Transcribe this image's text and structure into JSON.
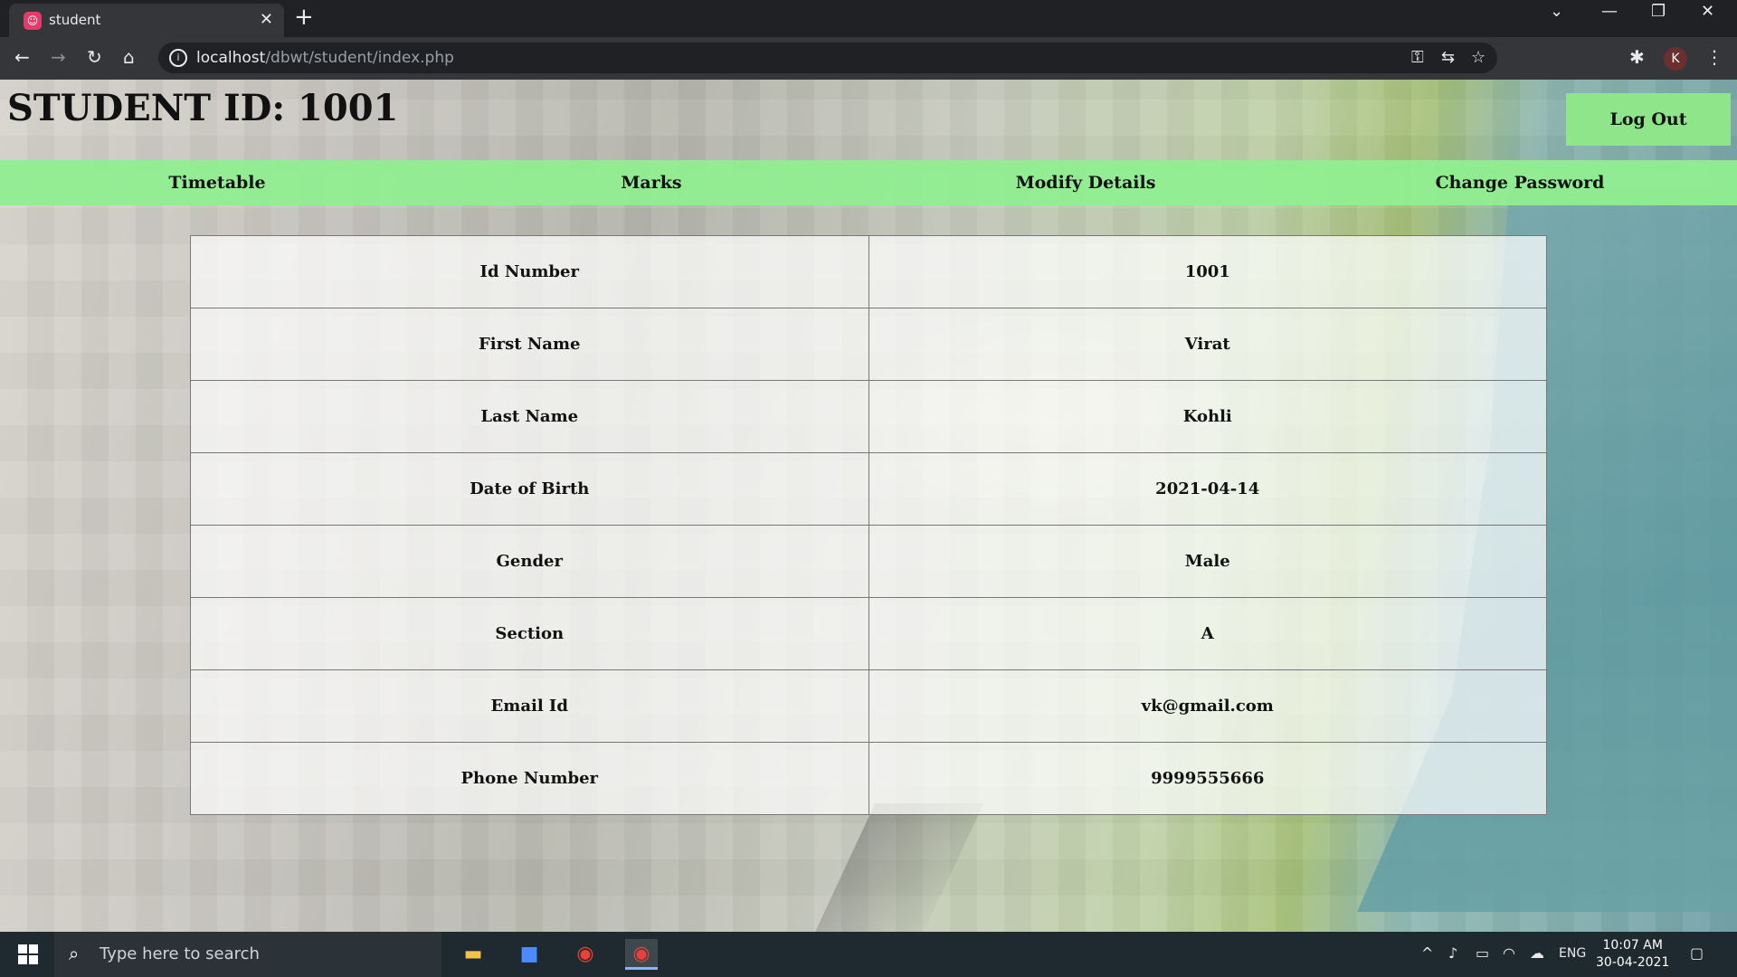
{
  "browser": {
    "tab_title": "student",
    "new_tab": "+",
    "url_host": "localhost",
    "url_path": "/dbwt/student/index.php"
  },
  "header": {
    "student_id_label": "STUDENT ID: 1001",
    "logout_label": "Log Out"
  },
  "menu": [
    "Timetable",
    "Marks",
    "Modify Details",
    "Change Password"
  ],
  "details": [
    {
      "label": "Id Number",
      "value": "1001"
    },
    {
      "label": "First Name",
      "value": "Virat"
    },
    {
      "label": "Last Name",
      "value": "Kohli"
    },
    {
      "label": "Date of Birth",
      "value": "2021-04-14"
    },
    {
      "label": "Gender",
      "value": "Male"
    },
    {
      "label": "Section",
      "value": "A"
    },
    {
      "label": "Email Id",
      "value": "vk@gmail.com"
    },
    {
      "label": "Phone Number",
      "value": "9999555666"
    }
  ],
  "taskbar": {
    "search_placeholder": "Type here to search",
    "language": "ENG",
    "time": "10:07 AM",
    "date": "30-04-2021"
  },
  "profile_initial": "K"
}
